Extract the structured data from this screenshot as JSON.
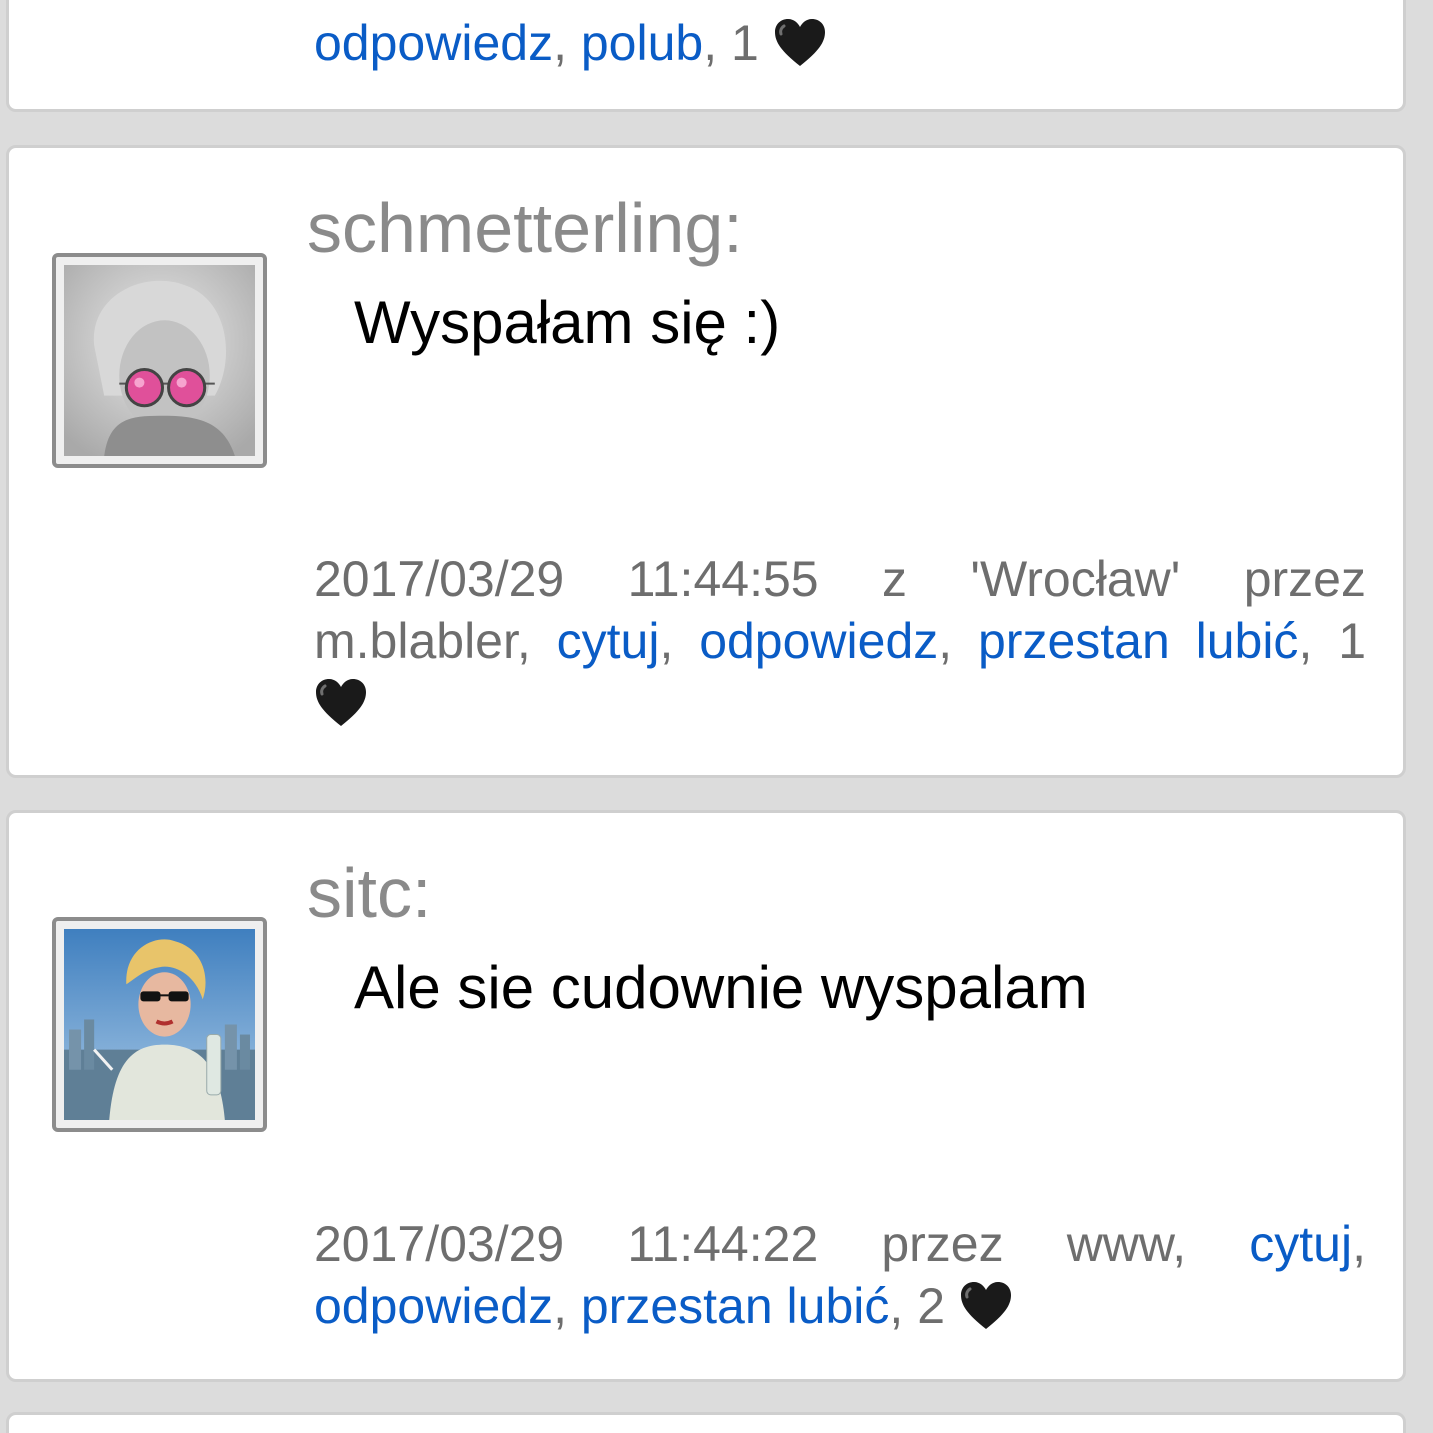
{
  "top_partial_post": {
    "reply_label": "odpowiedz",
    "like_label": "polub",
    "likes": "1"
  },
  "posts": [
    {
      "username": "schmetterling:",
      "message": "Wyspałam się :)",
      "timestamp": "2017/03/29 11:44:55",
      "from_label": "z",
      "location": "'Wrocław'",
      "by_label": "przez",
      "via": "m.blabler,",
      "quote_label": "cytuj",
      "reply_label": "odpowiedz",
      "unlike_label": "przestan lubić",
      "likes": "1",
      "avatar_icon": "woman-pink-glasses-avatar"
    },
    {
      "username": "sitc:",
      "message": "Ale sie cudownie wyspalam",
      "timestamp": "2017/03/29 11:44:22",
      "by_label": "przez",
      "via": "www,",
      "quote_label": "cytuj",
      "reply_label": "odpowiedz",
      "unlike_label": "przestan lubić",
      "likes": "2",
      "avatar_icon": "woman-sunglasses-city-avatar"
    }
  ],
  "colors": {
    "link": "#0a5cc6",
    "meta_text": "#6e6e6e",
    "username": "#8a8a8a",
    "background": "#dcdcdc",
    "card": "#ffffff",
    "heart": "#1a1a1a"
  }
}
